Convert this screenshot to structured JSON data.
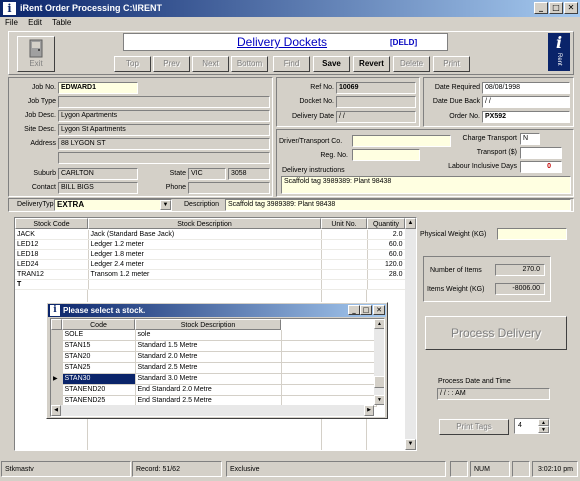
{
  "window": {
    "title": "iRent Order Processing    C:\\IRENT",
    "logo": "i",
    "min": "_",
    "max": "□",
    "close": "✕"
  },
  "menu": [
    "File",
    "Edit",
    "Table"
  ],
  "header": {
    "title": "Delivery Dockets",
    "code": "[DELD]",
    "exit": "Exit",
    "brand": "i Rent"
  },
  "toolbar": {
    "top": "Top",
    "prev": "Prev",
    "next": "Next",
    "bottom": "Bottom",
    "find": "Find",
    "save": "Save",
    "revert": "Revert",
    "delete": "Delete",
    "print": "Print"
  },
  "job": {
    "job_no_label": "Job No.",
    "job_no": "EDWARD1",
    "job_type_label": "Job Type",
    "job_type": "",
    "job_desc_label": "Job Desc.",
    "job_desc": "Lygon Apartments",
    "site_desc_label": "Site Desc.",
    "site_desc": "Lygon St Apartments",
    "address_label": "Address",
    "address1": "88 LYGON ST",
    "address2": "",
    "suburb_label": "Suburb",
    "suburb": "CARLTON",
    "state_label": "State",
    "state": "VIC",
    "postcode": "3058",
    "contact_label": "Contact",
    "contact": "BILL BIGS",
    "phone_label": "Phone",
    "phone": ""
  },
  "ref": {
    "ref_no_label": "Ref No.",
    "ref_no": "10069",
    "docket_label": "Docket No.",
    "docket": "",
    "delivery_date_label": "Delivery Date",
    "delivery_date": " / /"
  },
  "dates": {
    "required_label": "Date  Required",
    "required": "08/08/1998",
    "due_label": "Date Due Back",
    "due": " / /",
    "order_label": "Order No.",
    "order": "PX592"
  },
  "transport": {
    "driver_label": "Driver/Transport Co.",
    "driver": "",
    "reg_label": "Reg. No.",
    "reg": "",
    "charge_label": "Charge Transport",
    "charge": "N",
    "transport_label": "Transport ($)",
    "transport": "",
    "labour_label": "Labour Inclusive Days",
    "labour": "0",
    "instructions_label": "Delivery instructions",
    "instructions": "Scaffold tag 3989389: Plant 98438"
  },
  "delivery_type": {
    "label": "DeliveryType",
    "value": "EXTRA",
    "desc_label": "Description",
    "desc": "Scaffold tag 3989389: Plant 98438"
  },
  "grid": {
    "headers": [
      "Stock Code",
      "Stock Description",
      "Unit No.",
      "Quantity"
    ],
    "rows": [
      [
        "JACK",
        "Jack (Standard Base Jack)",
        "",
        "2.0"
      ],
      [
        "LED12",
        "Ledger 1.2 meter",
        "",
        "60.0"
      ],
      [
        "LED18",
        "Ledger 1.8 meter",
        "",
        "60.0"
      ],
      [
        "LED24",
        "Ledger 2.4 meter",
        "",
        "120.0"
      ],
      [
        "TRAN12",
        "Transom 1.2 meter",
        "",
        "28.0"
      ],
      [
        "T",
        "",
        "",
        ""
      ]
    ]
  },
  "right": {
    "phys_weight_label": "Physical Weight (KG)",
    "phys_weight": "",
    "items_label": "Number of Items",
    "items": "270.0",
    "items_weight_label": "Items Weight (KG)",
    "items_weight": "-8006.00",
    "process_button": "Process Delivery",
    "process_date_label": "Process Date and Time",
    "process_date": " / /      :  :  AM",
    "print_tags": "Print Tags",
    "tags_count": "4"
  },
  "popup": {
    "title": "Please select a stock.",
    "headers": [
      "Code",
      "Stock Description"
    ],
    "rows": [
      [
        "SOLE",
        "sole"
      ],
      [
        "STAN15",
        "Standard 1.5 Metre"
      ],
      [
        "STAN20",
        "Standard 2.0 Metre"
      ],
      [
        "STAN25",
        "Standard 2.5 Metre"
      ],
      [
        "STAN30",
        "Standard 3.0 Metre"
      ],
      [
        "STANEND20",
        "End Standard 2.0 Metre"
      ],
      [
        "STANEND25",
        "End Standard 2.5 Metre"
      ]
    ],
    "selected_index": 4
  },
  "status": {
    "user": "Stkmastv",
    "record": "Record: 51/62",
    "mode": "Exclusive",
    "num": "NUM",
    "time": "3:02:10 pm"
  }
}
